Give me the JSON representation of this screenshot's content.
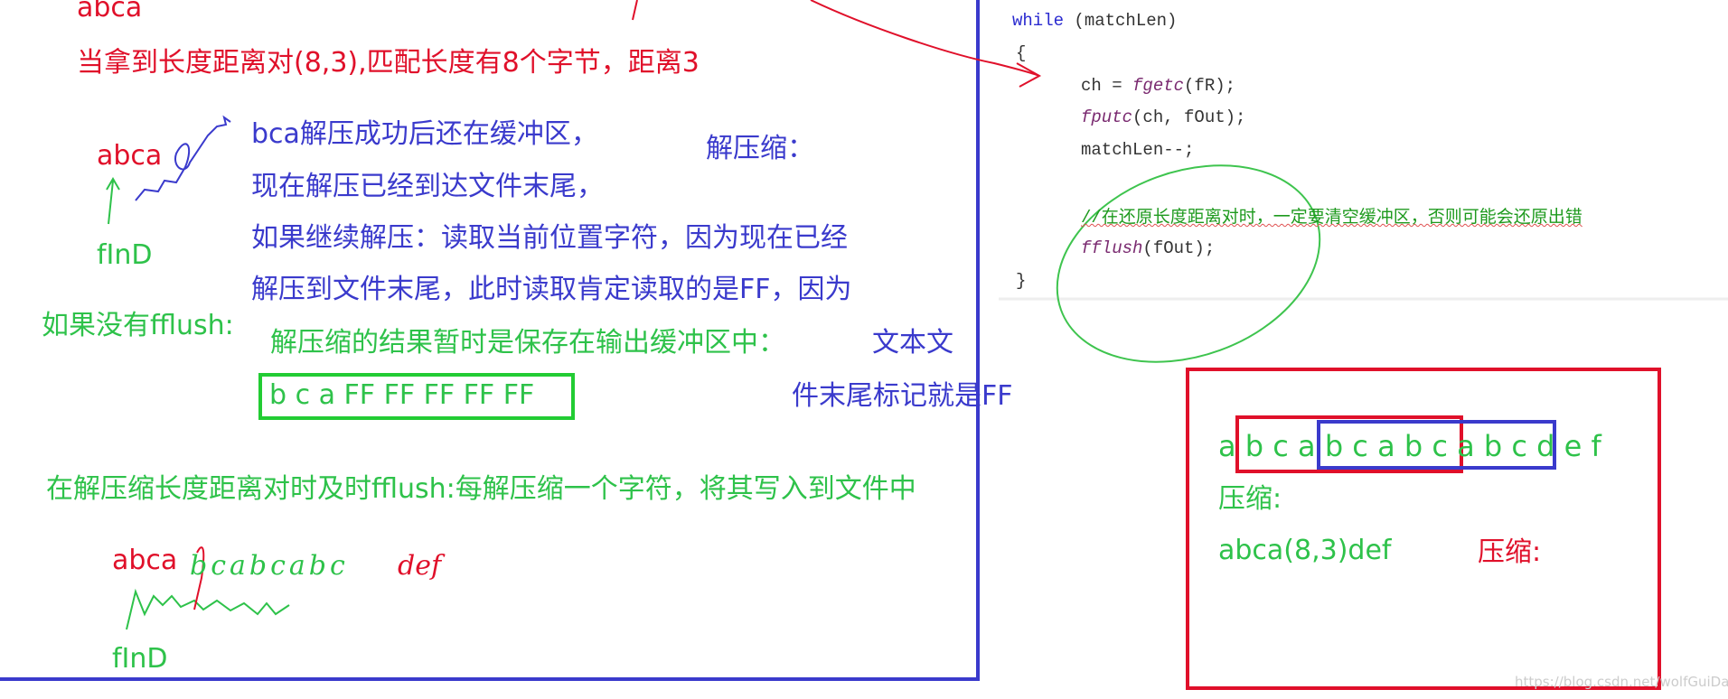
{
  "left": {
    "top_abca": "abca",
    "title": "当拿到长度距离对(8,3),匹配长度有8个字节，距离3",
    "abca_small": "abca",
    "find_label_1": "fInD",
    "blue_lines": [
      "bca解压成功后还在缓冲区，",
      "现在解压已经到达文件末尾，",
      "如果继续解压：读取当前位置字符，因为现在已经",
      "解压到文件末尾，此时读取肯定读取的是FF，因为"
    ],
    "decompress_label": "解压缩：",
    "no_fflush_label": "如果没有fflush:",
    "green_line": "解压缩的结果暂时是保存在输出缓冲区中：",
    "blue_tail_1": "文本文",
    "blue_tail_2": "件末尾标记就是FF",
    "buffer_box": "b c a FF FF FF FF FF",
    "fflush_note": "在解压缩长度距离对时及时fflush:每解压缩一个字符，将其写入到文件中",
    "bottom_abca": "abca",
    "bottom_handwritten": "bcabcabc",
    "bottom_handwritten_red": "def",
    "find_label_2": "fInD"
  },
  "code": {
    "lines": [
      {
        "kw": "while",
        "rest": " (matchLen)"
      },
      {
        "text": "{"
      },
      {
        "pre": "ch = ",
        "fn": "fgetc",
        "post": "(fR);"
      },
      {
        "fn": "fputc",
        "post": "(ch, fOut);"
      },
      {
        "text": "matchLen--;"
      },
      {
        "comment": "//在还原长度距离对时，一定要清空缓冲区，否则可能会还原出错"
      },
      {
        "fn": "fflush",
        "post": "(fOut);"
      },
      {
        "text": "}"
      }
    ]
  },
  "example": {
    "sequence": "a b c a b c a b c a b c d e f",
    "compress_label": "压缩:",
    "compressed": "abca(8,3)def",
    "compress_label_red": "压缩:"
  },
  "watermark": "https://blog.csdn.net/wolfGuiDao",
  "colors": {
    "red": "#e0102a",
    "blue": "#3a3acc",
    "green": "#2ec24a"
  }
}
